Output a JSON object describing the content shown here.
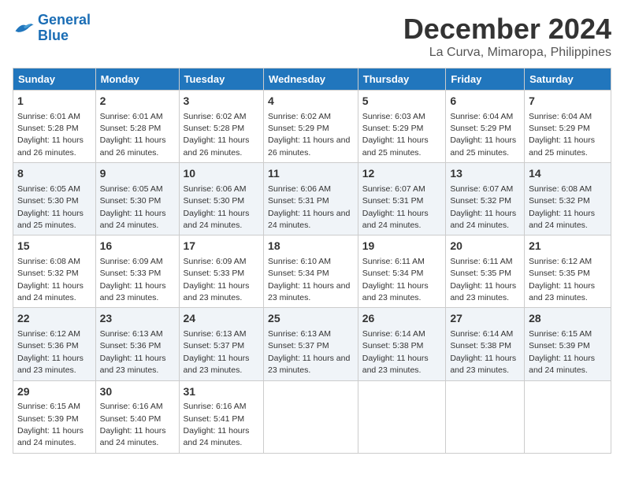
{
  "logo": {
    "line1": "General",
    "line2": "Blue"
  },
  "title": "December 2024",
  "subtitle": "La Curva, Mimaropa, Philippines",
  "days_of_week": [
    "Sunday",
    "Monday",
    "Tuesday",
    "Wednesday",
    "Thursday",
    "Friday",
    "Saturday"
  ],
  "weeks": [
    [
      {
        "day": "1",
        "rise": "6:01 AM",
        "set": "5:28 PM",
        "daylight": "11 hours and 26 minutes."
      },
      {
        "day": "2",
        "rise": "6:01 AM",
        "set": "5:28 PM",
        "daylight": "11 hours and 26 minutes."
      },
      {
        "day": "3",
        "rise": "6:02 AM",
        "set": "5:28 PM",
        "daylight": "11 hours and 26 minutes."
      },
      {
        "day": "4",
        "rise": "6:02 AM",
        "set": "5:29 PM",
        "daylight": "11 hours and 26 minutes."
      },
      {
        "day": "5",
        "rise": "6:03 AM",
        "set": "5:29 PM",
        "daylight": "11 hours and 25 minutes."
      },
      {
        "day": "6",
        "rise": "6:04 AM",
        "set": "5:29 PM",
        "daylight": "11 hours and 25 minutes."
      },
      {
        "day": "7",
        "rise": "6:04 AM",
        "set": "5:29 PM",
        "daylight": "11 hours and 25 minutes."
      }
    ],
    [
      {
        "day": "8",
        "rise": "6:05 AM",
        "set": "5:30 PM",
        "daylight": "11 hours and 25 minutes."
      },
      {
        "day": "9",
        "rise": "6:05 AM",
        "set": "5:30 PM",
        "daylight": "11 hours and 24 minutes."
      },
      {
        "day": "10",
        "rise": "6:06 AM",
        "set": "5:30 PM",
        "daylight": "11 hours and 24 minutes."
      },
      {
        "day": "11",
        "rise": "6:06 AM",
        "set": "5:31 PM",
        "daylight": "11 hours and 24 minutes."
      },
      {
        "day": "12",
        "rise": "6:07 AM",
        "set": "5:31 PM",
        "daylight": "11 hours and 24 minutes."
      },
      {
        "day": "13",
        "rise": "6:07 AM",
        "set": "5:32 PM",
        "daylight": "11 hours and 24 minutes."
      },
      {
        "day": "14",
        "rise": "6:08 AM",
        "set": "5:32 PM",
        "daylight": "11 hours and 24 minutes."
      }
    ],
    [
      {
        "day": "15",
        "rise": "6:08 AM",
        "set": "5:32 PM",
        "daylight": "11 hours and 24 minutes."
      },
      {
        "day": "16",
        "rise": "6:09 AM",
        "set": "5:33 PM",
        "daylight": "11 hours and 23 minutes."
      },
      {
        "day": "17",
        "rise": "6:09 AM",
        "set": "5:33 PM",
        "daylight": "11 hours and 23 minutes."
      },
      {
        "day": "18",
        "rise": "6:10 AM",
        "set": "5:34 PM",
        "daylight": "11 hours and 23 minutes."
      },
      {
        "day": "19",
        "rise": "6:11 AM",
        "set": "5:34 PM",
        "daylight": "11 hours and 23 minutes."
      },
      {
        "day": "20",
        "rise": "6:11 AM",
        "set": "5:35 PM",
        "daylight": "11 hours and 23 minutes."
      },
      {
        "day": "21",
        "rise": "6:12 AM",
        "set": "5:35 PM",
        "daylight": "11 hours and 23 minutes."
      }
    ],
    [
      {
        "day": "22",
        "rise": "6:12 AM",
        "set": "5:36 PM",
        "daylight": "11 hours and 23 minutes."
      },
      {
        "day": "23",
        "rise": "6:13 AM",
        "set": "5:36 PM",
        "daylight": "11 hours and 23 minutes."
      },
      {
        "day": "24",
        "rise": "6:13 AM",
        "set": "5:37 PM",
        "daylight": "11 hours and 23 minutes."
      },
      {
        "day": "25",
        "rise": "6:13 AM",
        "set": "5:37 PM",
        "daylight": "11 hours and 23 minutes."
      },
      {
        "day": "26",
        "rise": "6:14 AM",
        "set": "5:38 PM",
        "daylight": "11 hours and 23 minutes."
      },
      {
        "day": "27",
        "rise": "6:14 AM",
        "set": "5:38 PM",
        "daylight": "11 hours and 23 minutes."
      },
      {
        "day": "28",
        "rise": "6:15 AM",
        "set": "5:39 PM",
        "daylight": "11 hours and 24 minutes."
      }
    ],
    [
      {
        "day": "29",
        "rise": "6:15 AM",
        "set": "5:39 PM",
        "daylight": "11 hours and 24 minutes."
      },
      {
        "day": "30",
        "rise": "6:16 AM",
        "set": "5:40 PM",
        "daylight": "11 hours and 24 minutes."
      },
      {
        "day": "31",
        "rise": "6:16 AM",
        "set": "5:41 PM",
        "daylight": "11 hours and 24 minutes."
      },
      null,
      null,
      null,
      null
    ]
  ],
  "labels": {
    "sunrise": "Sunrise:",
    "sunset": "Sunset:",
    "daylight": "Daylight:"
  }
}
